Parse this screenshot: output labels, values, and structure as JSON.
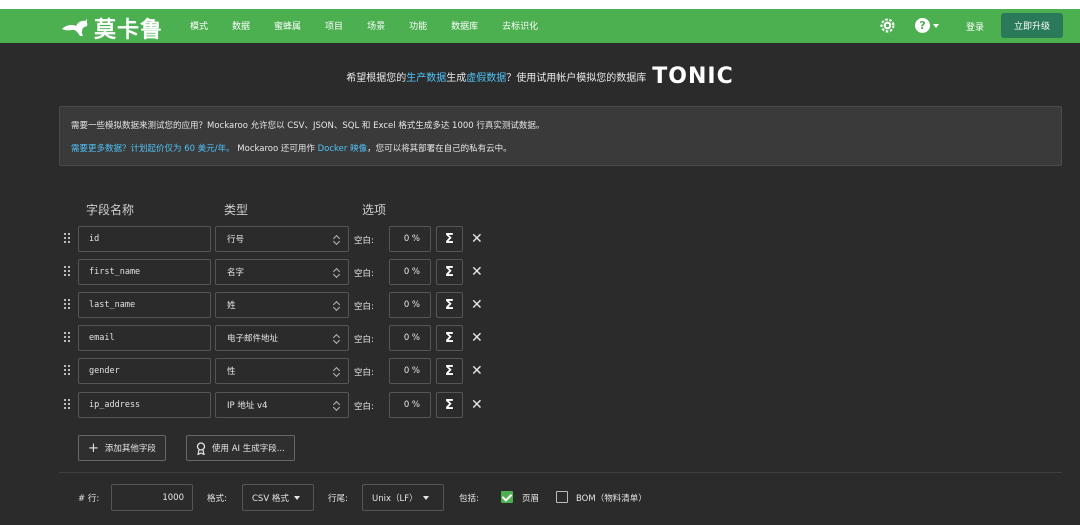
{
  "nav": {
    "logo_text": "莫卡鲁",
    "menu": [
      "模式",
      "数据",
      "蜜蜂属",
      "项目",
      "场景",
      "功能",
      "数据库",
      "去标识化"
    ],
    "help_label": "?",
    "login": "登录",
    "upgrade": "立即升级"
  },
  "promo": {
    "part1": "希望根据您的",
    "hl1": "生产数据",
    "part2": "生成",
    "hl2": "虚假数据",
    "part3": "？使用试用帐户模拟您的数据库",
    "brand": "TONIC"
  },
  "info": {
    "line1": "需要一些模拟数据来测试您的应用？Mockaroo 允许您以 CSV、JSON、SQL 和 Excel 格式生成多达 1000 行真实测试数据。",
    "line2_link": "需要更多数据？计划起价仅为 60 美元/年。",
    "line2_mid": " Mockaroo 还可用作 ",
    "line2_link2": "Docker 映像",
    "line2_end": "，您可以将其部署在自己的私有云中。"
  },
  "columns": {
    "name": "字段名称",
    "type": "类型",
    "options": "选项"
  },
  "fields": [
    {
      "name": "id",
      "type": "行号",
      "blank_label": "空白:",
      "blank": "0 %"
    },
    {
      "name": "first_name",
      "type": "名字",
      "blank_label": "空白:",
      "blank": "0 %"
    },
    {
      "name": "last_name",
      "type": "姓",
      "blank_label": "空白:",
      "blank": "0 %"
    },
    {
      "name": "email",
      "type": "电子邮件地址",
      "blank_label": "空白:",
      "blank": "0 %"
    },
    {
      "name": "gender",
      "type": "性",
      "blank_label": "空白:",
      "blank": "0 %"
    },
    {
      "name": "ip_address",
      "type": "IP 地址 v4",
      "blank_label": "空白:",
      "blank": "0 %"
    }
  ],
  "sigma_glyph": "Σ",
  "remove_glyph": "✕",
  "actions": {
    "add_field": "添加其他字段",
    "ai_fields": "使用 AI 生成字段..."
  },
  "bottom": {
    "rows_label": "# 行:",
    "rows_value": "1000",
    "format_label": "格式:",
    "format_value": "CSV 格式",
    "line_end_label": "行尾:",
    "line_end_value": "Unix（LF）",
    "include_label": "包括:",
    "header_label": "页眉",
    "header_checked": true,
    "bom_label": "BOM（物料清单）",
    "bom_checked": false
  },
  "colors": {
    "nav_bg": "#4caf50",
    "bg": "#2b2b2b",
    "link": "#4fc3f7",
    "upgrade_bg": "#2a7a5a"
  }
}
